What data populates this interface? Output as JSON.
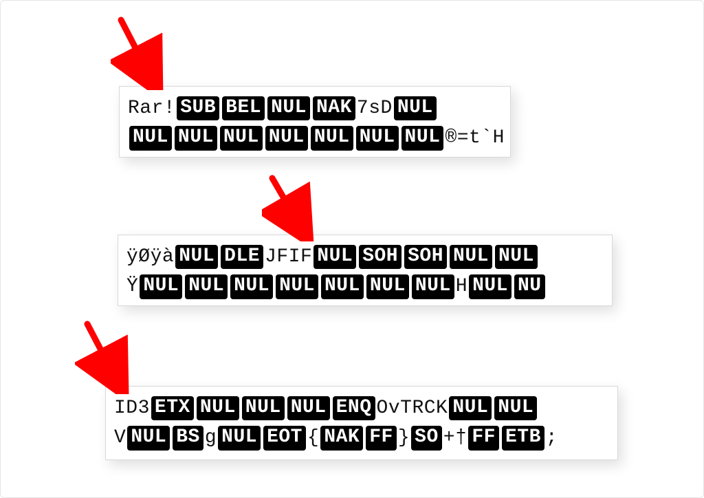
{
  "panels": {
    "rar": {
      "line1": [
        {
          "t": "plain",
          "v": "Rar!"
        },
        {
          "t": "cc",
          "v": "SUB"
        },
        {
          "t": "cc",
          "v": "BEL"
        },
        {
          "t": "cc",
          "v": "NUL"
        },
        {
          "t": "cc",
          "v": "NAK"
        },
        {
          "t": "plain",
          "v": "7sD"
        },
        {
          "t": "cc",
          "v": "NUL"
        }
      ],
      "line2": [
        {
          "t": "cc",
          "v": "NUL"
        },
        {
          "t": "cc",
          "v": "NUL"
        },
        {
          "t": "cc",
          "v": "NUL"
        },
        {
          "t": "cc",
          "v": "NUL"
        },
        {
          "t": "cc",
          "v": "NUL"
        },
        {
          "t": "cc",
          "v": "NUL"
        },
        {
          "t": "cc",
          "v": "NUL"
        },
        {
          "t": "plain",
          "v": "®=t`H"
        }
      ]
    },
    "jfif": {
      "line1": [
        {
          "t": "plain",
          "v": "ÿØÿà"
        },
        {
          "t": "cc",
          "v": "NUL"
        },
        {
          "t": "cc",
          "v": "DLE"
        },
        {
          "t": "plain",
          "v": "JFIF"
        },
        {
          "t": "cc",
          "v": "NUL"
        },
        {
          "t": "cc",
          "v": "SOH"
        },
        {
          "t": "cc",
          "v": "SOH"
        },
        {
          "t": "cc",
          "v": "NUL"
        },
        {
          "t": "cc",
          "v": "NUL"
        }
      ],
      "line2": [
        {
          "t": "plain",
          "v": "Ÿ"
        },
        {
          "t": "cc",
          "v": "NUL"
        },
        {
          "t": "cc",
          "v": "NUL"
        },
        {
          "t": "cc",
          "v": "NUL"
        },
        {
          "t": "cc",
          "v": "NUL"
        },
        {
          "t": "cc",
          "v": "NUL"
        },
        {
          "t": "cc",
          "v": "NUL"
        },
        {
          "t": "cc",
          "v": "NUL"
        },
        {
          "t": "plain",
          "v": "H"
        },
        {
          "t": "cc",
          "v": "NUL"
        },
        {
          "t": "cc",
          "v": "NU"
        }
      ]
    },
    "id3": {
      "line1": [
        {
          "t": "plain",
          "v": "ID3"
        },
        {
          "t": "cc",
          "v": "ETX"
        },
        {
          "t": "cc",
          "v": "NUL"
        },
        {
          "t": "cc",
          "v": "NUL"
        },
        {
          "t": "cc",
          "v": "NUL"
        },
        {
          "t": "cc",
          "v": "ENQ"
        },
        {
          "t": "plain",
          "v": "OvTRCK"
        },
        {
          "t": "cc",
          "v": "NUL"
        },
        {
          "t": "cc",
          "v": "NUL"
        }
      ],
      "line2": [
        {
          "t": "plain",
          "v": "V"
        },
        {
          "t": "cc",
          "v": "NUL"
        },
        {
          "t": "cc",
          "v": "BS"
        },
        {
          "t": "plain",
          "v": "g"
        },
        {
          "t": "cc",
          "v": "NUL"
        },
        {
          "t": "cc",
          "v": "EOT"
        },
        {
          "t": "plain",
          "v": "{"
        },
        {
          "t": "cc",
          "v": "NAK"
        },
        {
          "t": "cc",
          "v": "FF"
        },
        {
          "t": "plain",
          "v": "}"
        },
        {
          "t": "cc",
          "v": "SO"
        },
        {
          "t": "plain",
          "v": "+†"
        },
        {
          "t": "cc",
          "v": "FF"
        },
        {
          "t": "cc",
          "v": "ETB"
        },
        {
          "t": "plain",
          "v": ";"
        }
      ]
    }
  },
  "arrows": {
    "color": "#ff0000"
  }
}
